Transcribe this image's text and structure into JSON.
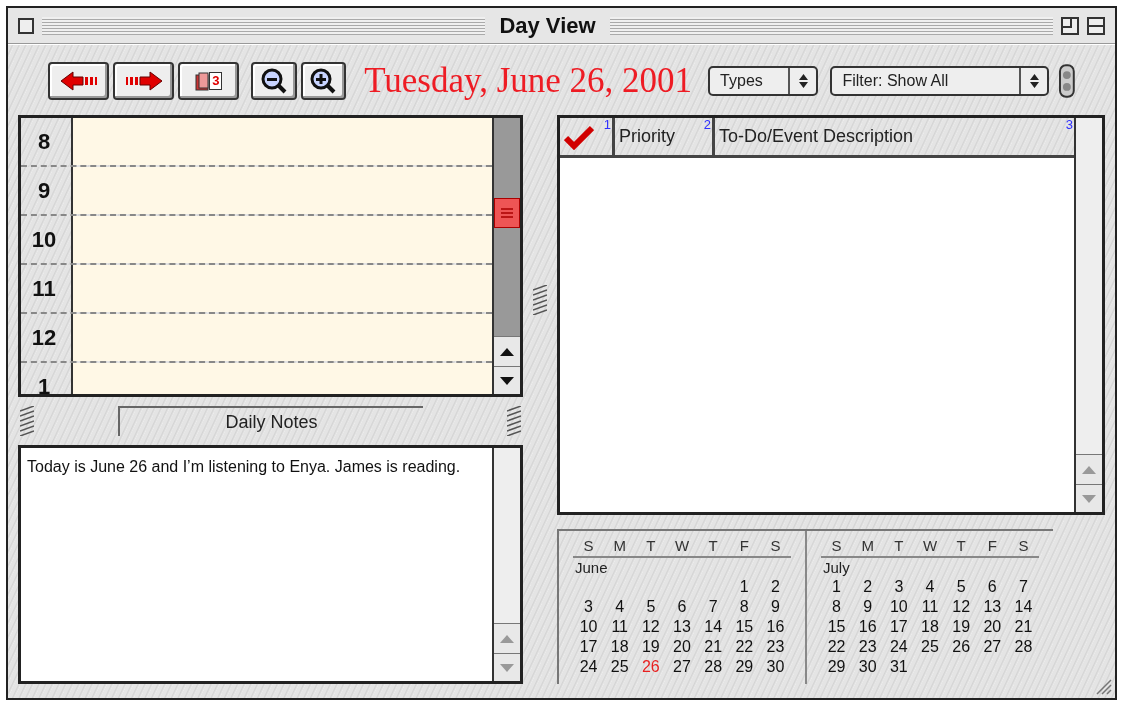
{
  "window": {
    "title": "Day View"
  },
  "toolbar": {
    "buttons": [
      {
        "kind": "back"
      },
      {
        "kind": "forward"
      },
      {
        "kind": "calendar",
        "badge": "3"
      },
      {
        "kind": "zoom-out"
      },
      {
        "kind": "zoom-in"
      }
    ],
    "date": "Tuesday, June 26, 2001",
    "popups": [
      {
        "label": "Types"
      },
      {
        "label": "Filter: Show All"
      }
    ]
  },
  "schedule": {
    "hours": [
      "8",
      "9",
      "10",
      "11",
      "12",
      "1"
    ]
  },
  "notes": {
    "title": "Daily Notes",
    "text": "Today is June 26 and I’m listening to Enya. James is reading."
  },
  "todo_table": {
    "columns": [
      {
        "kind": "check",
        "index": "1"
      },
      {
        "kind": "text",
        "label": "Priority",
        "index": "2"
      },
      {
        "kind": "text",
        "label": "To-Do/Event Description",
        "index": "3"
      }
    ]
  },
  "calendars": [
    {
      "weekdays": [
        "S",
        "M",
        "T",
        "W",
        "T",
        "F",
        "S"
      ],
      "month": "June",
      "weeks": [
        [
          {
            "kind": "blank"
          },
          {
            "kind": "blank"
          },
          {
            "kind": "blank"
          },
          {
            "kind": "blank"
          },
          {
            "kind": "blank"
          },
          {
            "kind": "day",
            "day": "1",
            "selected": false
          },
          {
            "kind": "day",
            "day": "2",
            "selected": false
          }
        ],
        [
          {
            "kind": "day",
            "day": "3",
            "selected": false
          },
          {
            "kind": "day",
            "day": "4",
            "selected": false
          },
          {
            "kind": "day",
            "day": "5",
            "selected": false
          },
          {
            "kind": "day",
            "day": "6",
            "selected": false
          },
          {
            "kind": "day",
            "day": "7",
            "selected": false
          },
          {
            "kind": "day",
            "day": "8",
            "selected": false
          },
          {
            "kind": "day",
            "day": "9",
            "selected": false
          }
        ],
        [
          {
            "kind": "day",
            "day": "10",
            "selected": false
          },
          {
            "kind": "day",
            "day": "11",
            "selected": false
          },
          {
            "kind": "day",
            "day": "12",
            "selected": false
          },
          {
            "kind": "day",
            "day": "13",
            "selected": false
          },
          {
            "kind": "day",
            "day": "14",
            "selected": false
          },
          {
            "kind": "day",
            "day": "15",
            "selected": false
          },
          {
            "kind": "day",
            "day": "16",
            "selected": false
          }
        ],
        [
          {
            "kind": "day",
            "day": "17",
            "selected": false
          },
          {
            "kind": "day",
            "day": "18",
            "selected": false
          },
          {
            "kind": "day",
            "day": "19",
            "selected": false
          },
          {
            "kind": "day",
            "day": "20",
            "selected": false
          },
          {
            "kind": "day",
            "day": "21",
            "selected": false
          },
          {
            "kind": "day",
            "day": "22",
            "selected": false
          },
          {
            "kind": "day",
            "day": "23",
            "selected": false
          }
        ],
        [
          {
            "kind": "day",
            "day": "24",
            "selected": false
          },
          {
            "kind": "day",
            "day": "25",
            "selected": false
          },
          {
            "kind": "day",
            "day": "26",
            "selected": true
          },
          {
            "kind": "day",
            "day": "27",
            "selected": false
          },
          {
            "kind": "day",
            "day": "28",
            "selected": false
          },
          {
            "kind": "day",
            "day": "29",
            "selected": false
          },
          {
            "kind": "day",
            "day": "30",
            "selected": false
          }
        ]
      ]
    },
    {
      "weekdays": [
        "S",
        "M",
        "T",
        "W",
        "T",
        "F",
        "S"
      ],
      "month": "July",
      "weeks": [
        [
          {
            "kind": "day",
            "day": "1",
            "selected": false
          },
          {
            "kind": "day",
            "day": "2",
            "selected": false
          },
          {
            "kind": "day",
            "day": "3",
            "selected": false
          },
          {
            "kind": "day",
            "day": "4",
            "selected": false
          },
          {
            "kind": "day",
            "day": "5",
            "selected": false
          },
          {
            "kind": "day",
            "day": "6",
            "selected": false
          },
          {
            "kind": "day",
            "day": "7",
            "selected": false
          }
        ],
        [
          {
            "kind": "day",
            "day": "8",
            "selected": false
          },
          {
            "kind": "day",
            "day": "9",
            "selected": false
          },
          {
            "kind": "day",
            "day": "10",
            "selected": false
          },
          {
            "kind": "day",
            "day": "11",
            "selected": false
          },
          {
            "kind": "day",
            "day": "12",
            "selected": false
          },
          {
            "kind": "day",
            "day": "13",
            "selected": false
          },
          {
            "kind": "day",
            "day": "14",
            "selected": false
          }
        ],
        [
          {
            "kind": "day",
            "day": "15",
            "selected": false
          },
          {
            "kind": "day",
            "day": "16",
            "selected": false
          },
          {
            "kind": "day",
            "day": "17",
            "selected": false
          },
          {
            "kind": "day",
            "day": "18",
            "selected": false
          },
          {
            "kind": "day",
            "day": "19",
            "selected": false
          },
          {
            "kind": "day",
            "day": "20",
            "selected": false
          },
          {
            "kind": "day",
            "day": "21",
            "selected": false
          }
        ],
        [
          {
            "kind": "day",
            "day": "22",
            "selected": false
          },
          {
            "kind": "day",
            "day": "23",
            "selected": false
          },
          {
            "kind": "day",
            "day": "24",
            "selected": false
          },
          {
            "kind": "day",
            "day": "25",
            "selected": false
          },
          {
            "kind": "day",
            "day": "26",
            "selected": false
          },
          {
            "kind": "day",
            "day": "27",
            "selected": false
          },
          {
            "kind": "day",
            "day": "28",
            "selected": false
          }
        ],
        [
          {
            "kind": "day",
            "day": "29",
            "selected": false
          },
          {
            "kind": "day",
            "day": "30",
            "selected": false
          },
          {
            "kind": "day",
            "day": "31",
            "selected": false
          },
          {
            "kind": "blank"
          },
          {
            "kind": "blank"
          },
          {
            "kind": "blank"
          },
          {
            "kind": "blank"
          }
        ]
      ]
    }
  ]
}
